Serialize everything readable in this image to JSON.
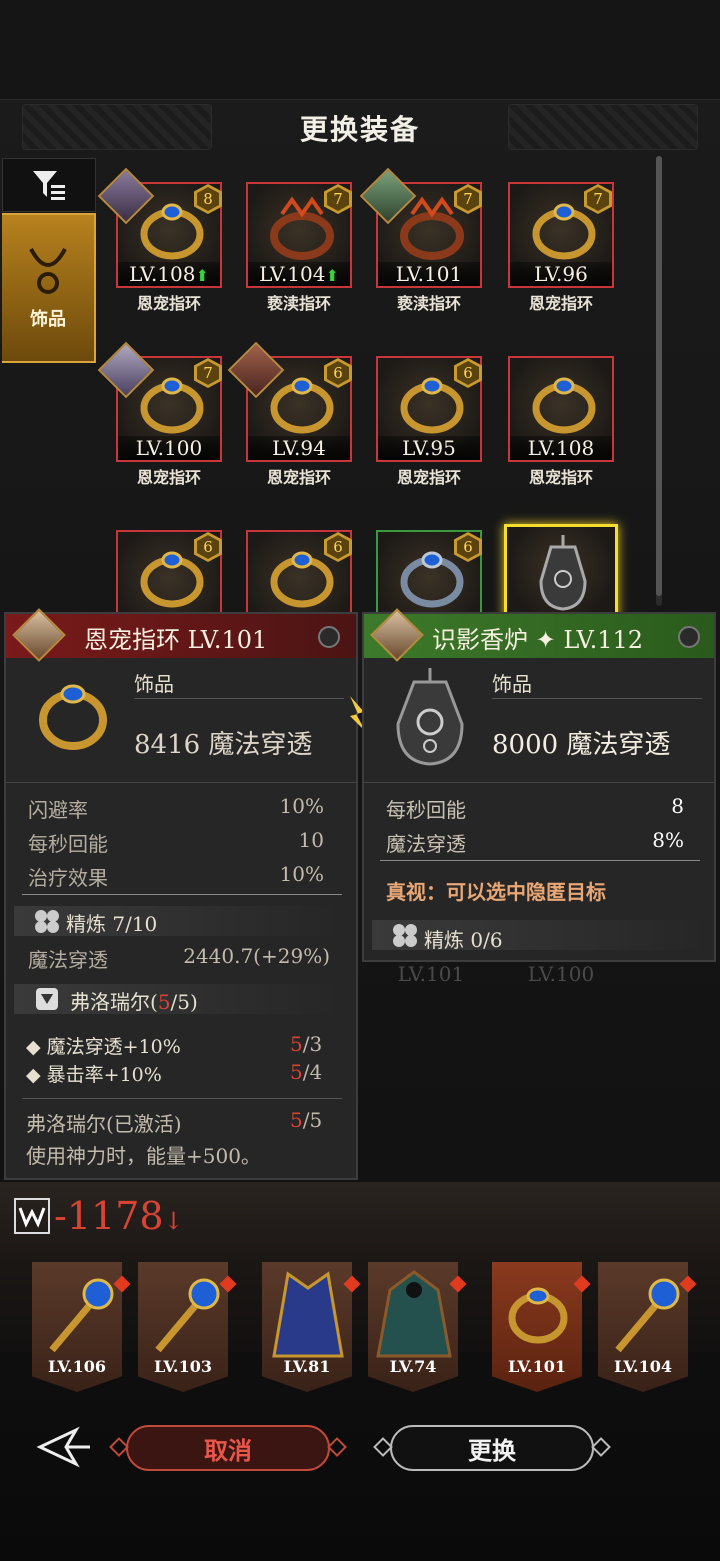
{
  "header": {
    "title": "更换装备"
  },
  "sidebar": {
    "filter_icon": "filter-icon",
    "category": "饰品"
  },
  "grid": [
    {
      "lv": "LV.108",
      "up": true,
      "name": "恩宠指环",
      "stars": "8",
      "avatar": true
    },
    {
      "lv": "LV.104",
      "up": true,
      "name": "亵渎指环",
      "stars": "7",
      "avatar": false
    },
    {
      "lv": "LV.101",
      "up": false,
      "name": "亵渎指环",
      "stars": "7",
      "avatar": true
    },
    {
      "lv": "LV.96",
      "up": false,
      "name": "恩宠指环",
      "stars": "7",
      "avatar": false
    },
    {
      "lv": "LV.100",
      "up": false,
      "name": "恩宠指环",
      "stars": "7",
      "avatar": true
    },
    {
      "lv": "LV.94",
      "up": false,
      "name": "恩宠指环",
      "stars": "6",
      "avatar": true
    },
    {
      "lv": "LV.95",
      "up": false,
      "name": "恩宠指环",
      "stars": "6",
      "avatar": false
    },
    {
      "lv": "LV.108",
      "up": false,
      "name": "恩宠指环",
      "stars": "",
      "avatar": false
    },
    {
      "lv": "",
      "up": false,
      "name": "",
      "stars": "6",
      "avatar": false
    },
    {
      "lv": "",
      "up": false,
      "name": "",
      "stars": "6",
      "avatar": false
    },
    {
      "lv": "LV.101",
      "up": false,
      "name": "",
      "stars": "6",
      "avatar": false
    },
    {
      "lv": "LV.100",
      "up": false,
      "name": "",
      "stars": "",
      "avatar": false
    }
  ],
  "left_panel": {
    "title": "恩宠指环 LV.101",
    "type": "饰品",
    "main_stat": "8416 魔法穿透",
    "stats": [
      {
        "name": "闪避率",
        "value": "10%"
      },
      {
        "name": "每秒回能",
        "value": "10"
      },
      {
        "name": "治疗效果",
        "value": "10%"
      }
    ],
    "refine": "精炼 7/10",
    "refine_stat": {
      "name": "魔法穿透",
      "value": "2440.7(+29%)"
    },
    "set_name": "弗洛瑞尔",
    "set_count": "5/5",
    "set_bonuses": [
      {
        "text": "魔法穿透+10%",
        "have": "5",
        "need": "/3"
      },
      {
        "text": "暴击率+10%",
        "have": "5",
        "need": "/4"
      }
    ],
    "set_active": "弗洛瑞尔(已激活)",
    "set_active_have": "5",
    "set_active_need": "/5",
    "set_desc": "使用神力时，能量+500。"
  },
  "right_panel": {
    "title": "识影香炉",
    "title_level": "LV.112",
    "type": "饰品",
    "main_stat": "8000 魔法穿透",
    "stats": [
      {
        "name": "每秒回能",
        "value": "8"
      },
      {
        "name": "魔法穿透",
        "value": "8%"
      }
    ],
    "special": "真视：可以选中隐匿目标",
    "refine": "精炼 0/6"
  },
  "power_change": {
    "value": "-1178",
    "arrow": "↓"
  },
  "equipped": [
    {
      "lv": "LV.106",
      "item": "staff"
    },
    {
      "lv": "LV.103",
      "item": "staff"
    },
    {
      "lv": "LV.81",
      "item": "robe"
    },
    {
      "lv": "LV.74",
      "item": "cloak"
    },
    {
      "lv": "LV.101",
      "item": "ring"
    },
    {
      "lv": "LV.104",
      "item": "staff"
    }
  ],
  "buttons": {
    "cancel": "取消",
    "confirm": "更换"
  },
  "colors": {
    "accent_gold": "#d9a53a",
    "danger_red": "#d84334",
    "select_yellow": "#f6dd2e"
  }
}
